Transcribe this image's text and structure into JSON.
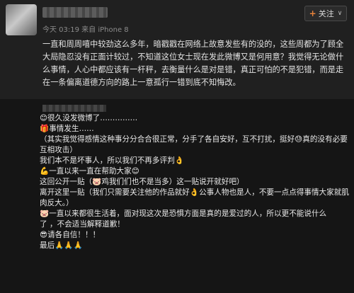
{
  "header": {
    "meta": "今天 03:19 来自 iPhone 8",
    "follow_label": "关注"
  },
  "post": {
    "text": "一直和周周嘻中较劲这么多年，暗戳戳在网络上故意发些有的没的，这些周都为了顾全大局隐忍没有正面计较过，不知道这位女士现在发此微博又是何用意？我觉得无论做什么事情，人心中都应该有一杆秤，去衡量什么是对是错，真正可怕的不是犯错，而是走在一条偏离道德方向的路上一意孤行一错到底不知悔改。"
  },
  "comments": {
    "lines": [
      "😊很久没发微博了……………",
      "",
      "🎁事情发生……",
      "（其实我觉得感情这种事分分合合很正常，分手了各自安好，互不打扰，挺好😓真的没有必要",
      "互相攻击）",
      "我们本不是坏事人，所以我们不再多评判👌",
      "💪一直以来一直在帮助大家😊",
      "这回公开一贴（🐷鸡我们们也不是当多）这一贴说开就好吧）",
      "离开这里一贴（我们只需要关注他的作品就好👌公事人物也是人，不要一点点得事情大家就肌",
      "肉反大。）",
      "🐷一直以来都很生活着，面对现这次是恐惧方面是真的是爱过的人，所以更不能说什么",
      "了    ，不会适当解释道歉！",
      "😎请各自信！！！",
      "最后🙏🙏🙏"
    ]
  }
}
